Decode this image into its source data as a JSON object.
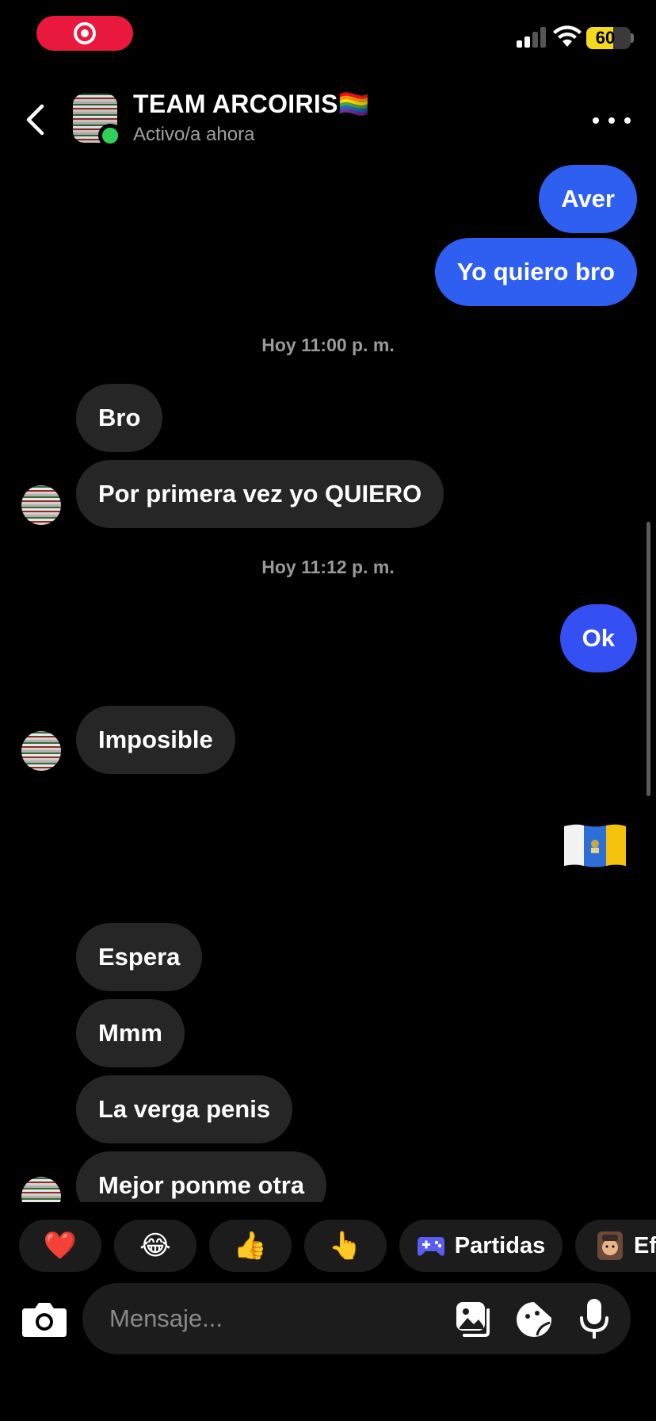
{
  "status_bar": {
    "battery": "60",
    "battery_level": 0.6
  },
  "header": {
    "title": "TEAM ARCOIRIS🏳️‍🌈",
    "subtitle": "Activo/a ahora"
  },
  "messages": {
    "out_1": "Aver",
    "out_2": "Yo quiero bro",
    "timestamp_1": "Hoy 11:00 p. m.",
    "in_1": "Bro",
    "in_2": "Por primera vez yo QUIERO",
    "timestamp_2": "Hoy 11:12 p. m.",
    "out_3": "Ok",
    "in_3": "Imposible",
    "in_4": "Espera",
    "in_5": "Mmm",
    "in_6": "La verga penis",
    "in_7": "Mejor ponme otra"
  },
  "quick_reactions": {
    "heart": "❤️",
    "laugh": "😂",
    "thumbs_up": "👍",
    "pointing": "👆",
    "games_label": "Partidas",
    "effects_label": "Efe"
  },
  "composer": {
    "placeholder": "Mensaje..."
  },
  "colors": {
    "outgoing": "#2f5ff0",
    "incoming": "#262626",
    "record": "#e8193c",
    "online": "#30d158",
    "battery": "#f4d91e"
  },
  "icons": [
    "record-icon",
    "signal-icon",
    "wifi-icon",
    "battery-icon",
    "back-arrow-icon",
    "more-dots-icon",
    "canary-flag-icon",
    "chevron-down-icon",
    "gamepad-icon",
    "camera-icon",
    "gallery-icon",
    "sticker-icon",
    "mic-icon"
  ]
}
